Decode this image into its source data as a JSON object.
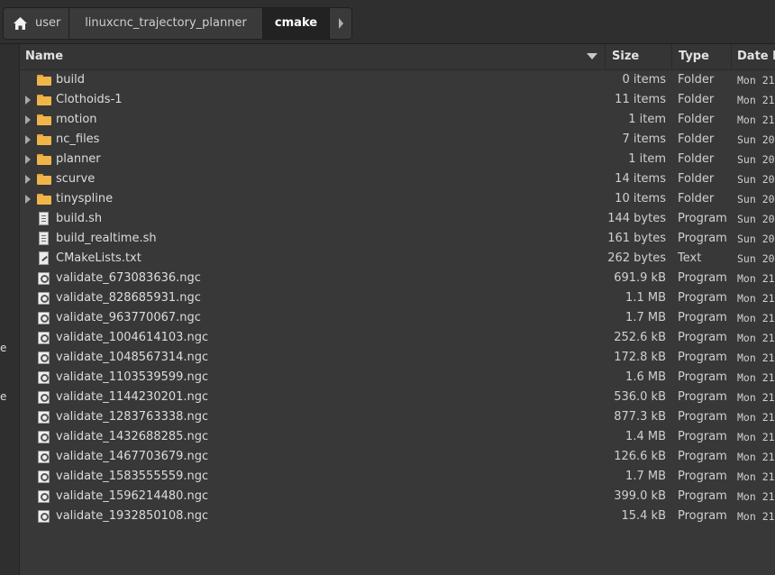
{
  "breadcrumb": {
    "home": "user",
    "project": "linuxcnc_trajectory_planner",
    "current": "cmake"
  },
  "side": {
    "glyph_a": "e",
    "glyph_b": "e"
  },
  "columns": {
    "name": "Name",
    "size": "Size",
    "type": "Type",
    "date": "Date M"
  },
  "rows": [
    {
      "name": "build",
      "size": "0 items",
      "type": "Folder",
      "date": "Mon 21",
      "kind": "folder",
      "expandable": false
    },
    {
      "name": "Clothoids-1",
      "size": "11 items",
      "type": "Folder",
      "date": "Mon 21",
      "kind": "folder",
      "expandable": true
    },
    {
      "name": "motion",
      "size": "1 item",
      "type": "Folder",
      "date": "Mon 21",
      "kind": "folder",
      "expandable": true
    },
    {
      "name": "nc_files",
      "size": "7 items",
      "type": "Folder",
      "date": "Sun 20",
      "kind": "folder",
      "expandable": true
    },
    {
      "name": "planner",
      "size": "1 item",
      "type": "Folder",
      "date": "Sun 20",
      "kind": "folder",
      "expandable": true
    },
    {
      "name": "scurve",
      "size": "14 items",
      "type": "Folder",
      "date": "Sun 20",
      "kind": "folder",
      "expandable": true
    },
    {
      "name": "tinyspline",
      "size": "10 items",
      "type": "Folder",
      "date": "Sun 20",
      "kind": "folder",
      "expandable": true
    },
    {
      "name": "build.sh",
      "size": "144 bytes",
      "type": "Program",
      "date": "Sun 20",
      "kind": "script",
      "expandable": false
    },
    {
      "name": "build_realtime.sh",
      "size": "161 bytes",
      "type": "Program",
      "date": "Sun 20",
      "kind": "script",
      "expandable": false
    },
    {
      "name": "CMakeLists.txt",
      "size": "262 bytes",
      "type": "Text",
      "date": "Sun 20",
      "kind": "text",
      "expandable": false
    },
    {
      "name": "validate_673083636.ngc",
      "size": "691.9 kB",
      "type": "Program",
      "date": "Mon 21",
      "kind": "program",
      "expandable": false
    },
    {
      "name": "validate_828685931.ngc",
      "size": "1.1 MB",
      "type": "Program",
      "date": "Mon 21",
      "kind": "program",
      "expandable": false
    },
    {
      "name": "validate_963770067.ngc",
      "size": "1.7 MB",
      "type": "Program",
      "date": "Mon 21",
      "kind": "program",
      "expandable": false
    },
    {
      "name": "validate_1004614103.ngc",
      "size": "252.6 kB",
      "type": "Program",
      "date": "Mon 21",
      "kind": "program",
      "expandable": false
    },
    {
      "name": "validate_1048567314.ngc",
      "size": "172.8 kB",
      "type": "Program",
      "date": "Mon 21",
      "kind": "program",
      "expandable": false
    },
    {
      "name": "validate_1103539599.ngc",
      "size": "1.6 MB",
      "type": "Program",
      "date": "Mon 21",
      "kind": "program",
      "expandable": false
    },
    {
      "name": "validate_1144230201.ngc",
      "size": "536.0 kB",
      "type": "Program",
      "date": "Mon 21",
      "kind": "program",
      "expandable": false
    },
    {
      "name": "validate_1283763338.ngc",
      "size": "877.3 kB",
      "type": "Program",
      "date": "Mon 21",
      "kind": "program",
      "expandable": false
    },
    {
      "name": "validate_1432688285.ngc",
      "size": "1.4 MB",
      "type": "Program",
      "date": "Mon 21",
      "kind": "program",
      "expandable": false
    },
    {
      "name": "validate_1467703679.ngc",
      "size": "126.6 kB",
      "type": "Program",
      "date": "Mon 21",
      "kind": "program",
      "expandable": false
    },
    {
      "name": "validate_1583555559.ngc",
      "size": "1.7 MB",
      "type": "Program",
      "date": "Mon 21",
      "kind": "program",
      "expandable": false
    },
    {
      "name": "validate_1596214480.ngc",
      "size": "399.0 kB",
      "type": "Program",
      "date": "Mon 21",
      "kind": "program",
      "expandable": false
    },
    {
      "name": "validate_1932850108.ngc",
      "size": "15.4 kB",
      "type": "Program",
      "date": "Mon 21",
      "kind": "program",
      "expandable": false
    }
  ]
}
